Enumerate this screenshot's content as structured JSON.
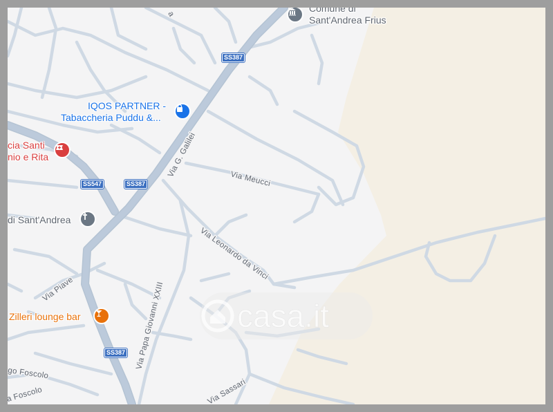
{
  "map": {
    "colors": {
      "land": "#f4f4f5",
      "sand": "#f4efe4",
      "road_minor": "#cfd9e4",
      "road_major": "#b4c3d3",
      "frame": "#9e9e9e"
    },
    "streets": [
      "Via G. Galilei",
      "Via Meucci",
      "Via Leonardo da Vinci",
      "Via Papa Giovanni XXIII",
      "Via Piave",
      "Via Sassari",
      "go Foscolo",
      "a Foscolo"
    ],
    "shields": [
      "SS387",
      "SS547",
      "SS387",
      "SS387"
    ],
    "pois": [
      {
        "name": "Comune di",
        "name2": "Sant'Andrea Frius",
        "icon": "town-hall-icon",
        "color": "#6b7784"
      },
      {
        "name": "IQOS PARTNER -",
        "name2": "Tabaccheria Puddu &...",
        "icon": "shopping-bag-icon",
        "color": "#1a73e8"
      },
      {
        "name": "cia Santi",
        "name2": "nio e Rita",
        "icon": "pharmacy-icon",
        "color": "#d93f3f"
      },
      {
        "name": "di Sant'Andrea",
        "icon": "church-icon",
        "color": "#6b7784"
      },
      {
        "name": "Zilleri lounge bar",
        "icon": "cocktail-icon",
        "color": "#e8710a"
      }
    ],
    "watermark": "casa.it"
  }
}
